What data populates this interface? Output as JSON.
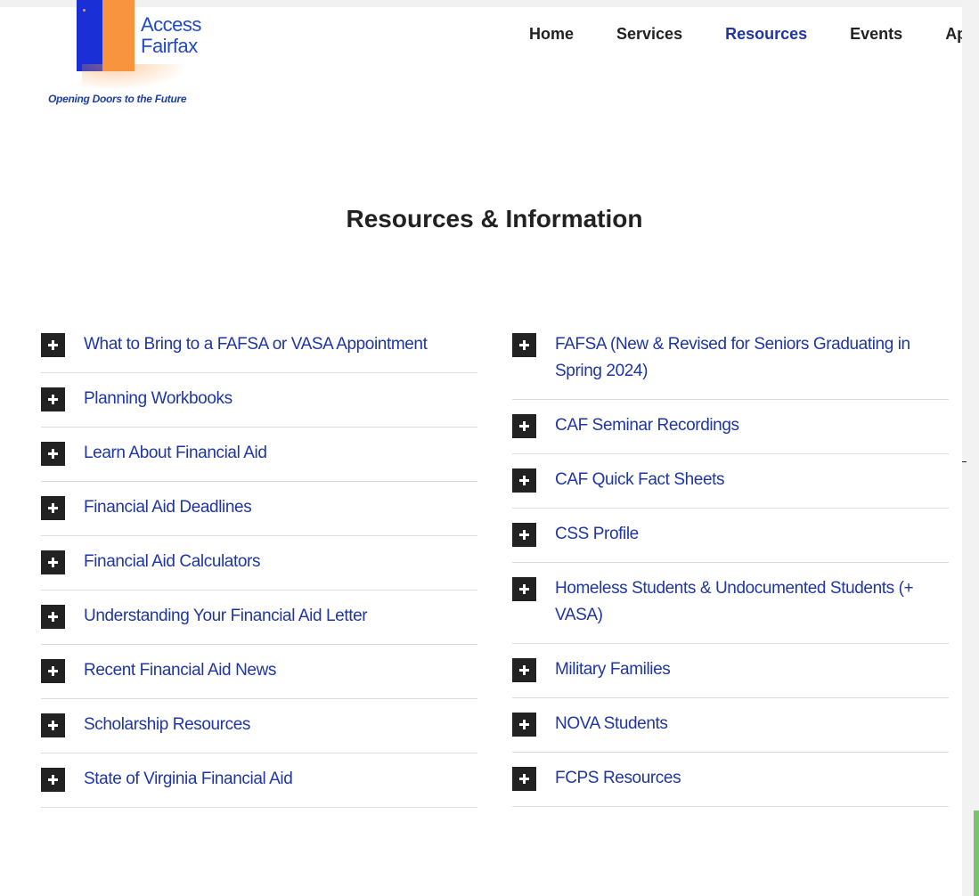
{
  "logo": {
    "line1": "Access",
    "line2": "Fairfax",
    "tagline": "Opening Doors to the Future"
  },
  "nav": {
    "items": [
      {
        "label": "Home",
        "active": false
      },
      {
        "label": "Services",
        "active": false
      },
      {
        "label": "Resources",
        "active": true
      },
      {
        "label": "Events",
        "active": false
      },
      {
        "label": "Appoi",
        "active": false
      }
    ]
  },
  "page": {
    "title": "Resources & Information"
  },
  "resources": {
    "left": [
      "What to Bring to a FAFSA or VASA Appointment",
      "Planning Workbooks",
      "Learn About Financial Aid",
      "Financial Aid Deadlines",
      "Financial Aid Calculators",
      "Understanding Your Financial Aid Letter",
      "Recent Financial Aid News",
      "Scholarship Resources",
      "State of Virginia Financial Aid"
    ],
    "right": [
      "FAFSA (New & Revised for Seniors Graduating in Spring 2024)",
      "CAF Seminar Recordings",
      "CAF Quick Fact Sheets",
      "CSS Profile",
      "Homeless Students & Undocumented Students (+ VASA)",
      "Military Families",
      "NOVA Students",
      "FCPS Resources"
    ]
  },
  "colors": {
    "link": "#1f36a3",
    "logo_blue": "#1a2fd6",
    "logo_orange": "#f7943d",
    "icon_bg": "#222222"
  }
}
